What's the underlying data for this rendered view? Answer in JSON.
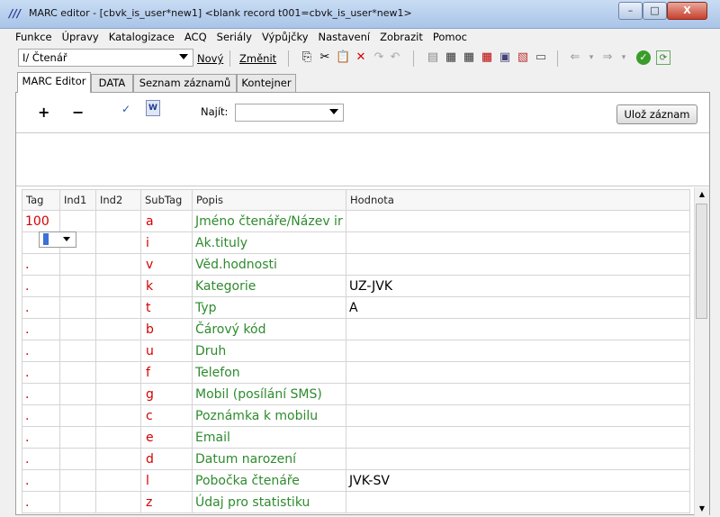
{
  "window": {
    "title": "MARC editor - [cbvk_is_user*new1] <blank record t001=cbvk_is_user*new1>",
    "minimize": "–",
    "maximize": "□",
    "close": "X"
  },
  "menu": [
    "Funkce",
    "Úpravy",
    "Katalogizace",
    "ACQ",
    "Seriály",
    "Výpůjčky",
    "Nastavení",
    "Zobrazit",
    "Pomoc"
  ],
  "toolbar": {
    "record_type": "I/ Čtenář",
    "new_label": "Nový",
    "change_label": "Změnit",
    "icons": [
      "copy-icon",
      "cut-icon",
      "paste-icon",
      "delete-icon",
      "redo-icon",
      "undo-icon",
      "list-icon",
      "print-icon",
      "print2-icon",
      "print3-icon",
      "grid-icon",
      "form-icon",
      "window-icon",
      "back-icon",
      "forward-icon",
      "ok-icon",
      "refresh-icon"
    ]
  },
  "tabs": [
    "MARC Editor",
    "DATA",
    "Seznam záznamů",
    "Kontejner"
  ],
  "editor": {
    "add_label": "+",
    "remove_label": "−",
    "find_label": "Najít:",
    "find_value": "",
    "save_label": "Ulož záznam"
  },
  "table": {
    "columns": [
      "Tag",
      "Ind1",
      "Ind2",
      "SubTag",
      "Popis",
      "Hodnota"
    ],
    "rows": [
      {
        "tag": "100",
        "ind1": "",
        "ind2": "",
        "sub": "a",
        "popis": "Jméno čtenáře/Název ir",
        "value": ""
      },
      {
        "tag": ".",
        "ind1": "",
        "ind2": "",
        "sub": "i",
        "popis": "Ak.tituly",
        "value": ""
      },
      {
        "tag": ".",
        "ind1": "",
        "ind2": "",
        "sub": "v",
        "popis": "Věd.hodnosti",
        "value": ""
      },
      {
        "tag": ".",
        "ind1": "",
        "ind2": "",
        "sub": "k",
        "popis": "Kategorie",
        "value": "UZ-JVK"
      },
      {
        "tag": ".",
        "ind1": "",
        "ind2": "",
        "sub": "t",
        "popis": "Typ",
        "value": "A"
      },
      {
        "tag": ".",
        "ind1": "",
        "ind2": "",
        "sub": "b",
        "popis": "Čárový kód",
        "value": ""
      },
      {
        "tag": ".",
        "ind1": "",
        "ind2": "",
        "sub": "u",
        "popis": "Druh",
        "value": ""
      },
      {
        "tag": ".",
        "ind1": "",
        "ind2": "",
        "sub": "f",
        "popis": "Telefon",
        "value": ""
      },
      {
        "tag": ".",
        "ind1": "",
        "ind2": "",
        "sub": "g",
        "popis": "Mobil (posílání SMS)",
        "value": ""
      },
      {
        "tag": ".",
        "ind1": "",
        "ind2": "",
        "sub": "c",
        "popis": "Poznámka k mobilu",
        "value": ""
      },
      {
        "tag": ".",
        "ind1": "",
        "ind2": "",
        "sub": "e",
        "popis": "Email",
        "value": ""
      },
      {
        "tag": ".",
        "ind1": "",
        "ind2": "",
        "sub": "d",
        "popis": "Datum narození",
        "value": ""
      },
      {
        "tag": ".",
        "ind1": "",
        "ind2": "",
        "sub": "l",
        "popis": "Pobočka čtenáře",
        "value": "JVK-SV"
      },
      {
        "tag": ".",
        "ind1": "",
        "ind2": "",
        "sub": "z",
        "popis": "Údaj pro statistiku",
        "value": ""
      }
    ]
  }
}
